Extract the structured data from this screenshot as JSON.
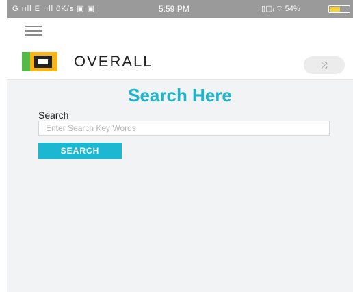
{
  "status_bar": {
    "left_text": "G ııll E ııll 0K/s ▣ ▣",
    "time": "5:59 PM",
    "right_text": "▯▢ᵢ ⌔ 54%",
    "battery_level": 0.54,
    "battery_color": "#f5d33b"
  },
  "top_bar": {
    "menu_icon": "hamburger-menu-icon"
  },
  "brand": {
    "name": "OVERALL",
    "logo_colors": {
      "green": "#55b947",
      "orange": "#f4b41a",
      "dark": "#232323"
    },
    "action_icon": "⤨"
  },
  "main": {
    "title": "Search Here",
    "search_label": "Search",
    "search_placeholder": "Enter Search Key Words",
    "search_value": "",
    "search_button_label": "SEARCH"
  },
  "colors": {
    "accent": "#1eb4cc",
    "button": "#1cb7d1",
    "background": "#f2f3f5"
  }
}
